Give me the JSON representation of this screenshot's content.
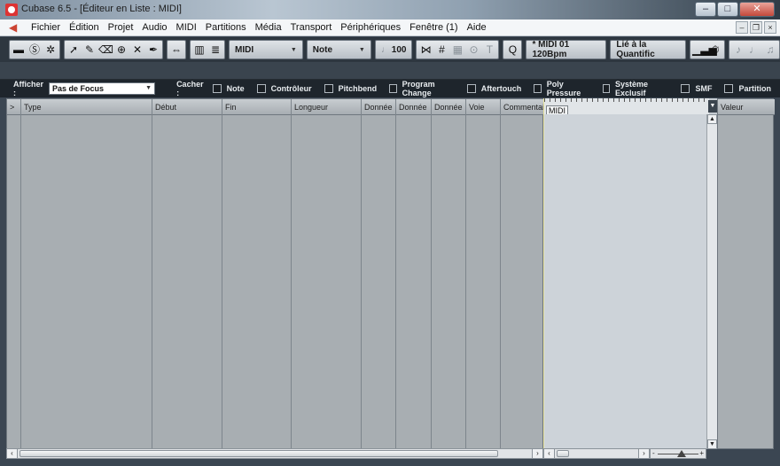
{
  "window": {
    "title": "Cubase 6.5 - [Éditeur en Liste : MIDI]",
    "controls": [
      "–",
      "□",
      "✕"
    ]
  },
  "menu": {
    "items": [
      "Fichier",
      "Édition",
      "Projet",
      "Audio",
      "MIDI",
      "Partitions",
      "Média",
      "Transport",
      "Périphériques",
      "Fenêtre (1)",
      "Aide"
    ]
  },
  "toolbar": {
    "track_select": "MIDI",
    "insert_type": "Note",
    "velocity": "100",
    "quantize": "* MIDI 01 120Bpm",
    "length_quantize": "Lié à la Quantific"
  },
  "filter": {
    "show_label": "Afficher :",
    "show_value": "Pas de Focus",
    "hide_label": "Cacher :",
    "options": [
      "Note",
      "Contrôleur",
      "Pitchbend",
      "Program Change",
      "Aftertouch",
      "Poly Pressure",
      "Système Exclusif",
      "SMF",
      "Partition"
    ]
  },
  "list": {
    "columns": [
      ">",
      "Type",
      "Début",
      "Fin",
      "Longueur",
      "Donnée",
      "Donnée",
      "Donnée",
      "Voie",
      "Commentaire"
    ]
  },
  "graph": {
    "ruler_label": "MIDI"
  },
  "value_col": {
    "header": "Valeur"
  }
}
